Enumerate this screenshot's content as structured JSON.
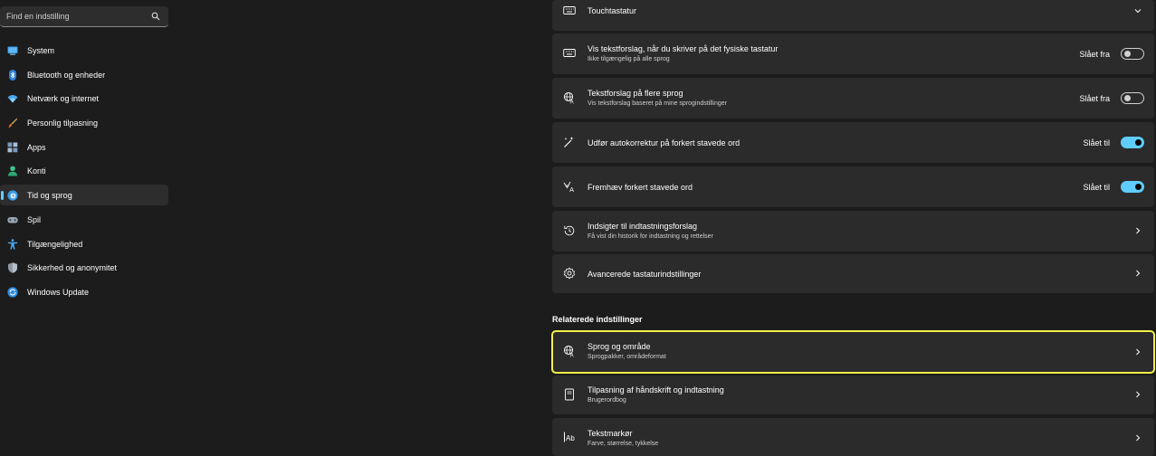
{
  "search": {
    "placeholder": "Find en indstilling"
  },
  "sidebar": {
    "items": [
      {
        "label": "System"
      },
      {
        "label": "Bluetooth og enheder"
      },
      {
        "label": "Netværk og internet"
      },
      {
        "label": "Personlig tilpasning"
      },
      {
        "label": "Apps"
      },
      {
        "label": "Konti"
      },
      {
        "label": "Tid og sprog",
        "active": true
      },
      {
        "label": "Spil"
      },
      {
        "label": "Tilgængelighed"
      },
      {
        "label": "Sikkerhed og anonymitet"
      },
      {
        "label": "Windows Update"
      }
    ]
  },
  "settings": [
    {
      "title": "Touchtastatur",
      "icon": "keyboard-icon",
      "action": "expand"
    },
    {
      "title": "Vis tekstforslag, når du skriver på det fysiske tastatur",
      "subtitle": "Ikke tilgængelig på alle sprog",
      "icon": "keyboard-icon",
      "state": "Slået fra",
      "toggle": false
    },
    {
      "title": "Tekstforslag på flere sprog",
      "subtitle": "Vis tekstforslag baseret på mine sprogindstillinger",
      "icon": "language-icon",
      "state": "Slået fra",
      "toggle": false
    },
    {
      "title": "Udfør autokorrektur på forkert stavede ord",
      "icon": "magic-wand-icon",
      "state": "Slået til",
      "toggle": true
    },
    {
      "title": "Fremhæv forkert stavede ord",
      "icon": "spellcheck-icon",
      "state": "Slået til",
      "toggle": true
    },
    {
      "title": "Indsigter til indtastningsforslag",
      "subtitle": "Få vist din historik for indtastning og rettelser",
      "icon": "history-icon",
      "action": "navigate"
    },
    {
      "title": "Avancerede tastaturindstillinger",
      "icon": "gear-icon",
      "action": "navigate"
    }
  ],
  "related": {
    "title": "Relaterede indstillinger",
    "items": [
      {
        "title": "Sprog og område",
        "subtitle": "Sprogpakker, områdeformat",
        "icon": "language-icon",
        "highlighted": true
      },
      {
        "title": "Tilpasning af håndskrift og indtastning",
        "subtitle": "Brugerordbog",
        "icon": "notebook-icon"
      },
      {
        "title": "Tekstmarkør",
        "subtitle": "Farve, størrelse, tykkelse",
        "icon": "text-cursor-icon"
      }
    ]
  },
  "colors": {
    "accent": "#60cdff",
    "highlight": "#f2f246",
    "card": "#2b2b2b",
    "background": "#1c1c1c"
  }
}
